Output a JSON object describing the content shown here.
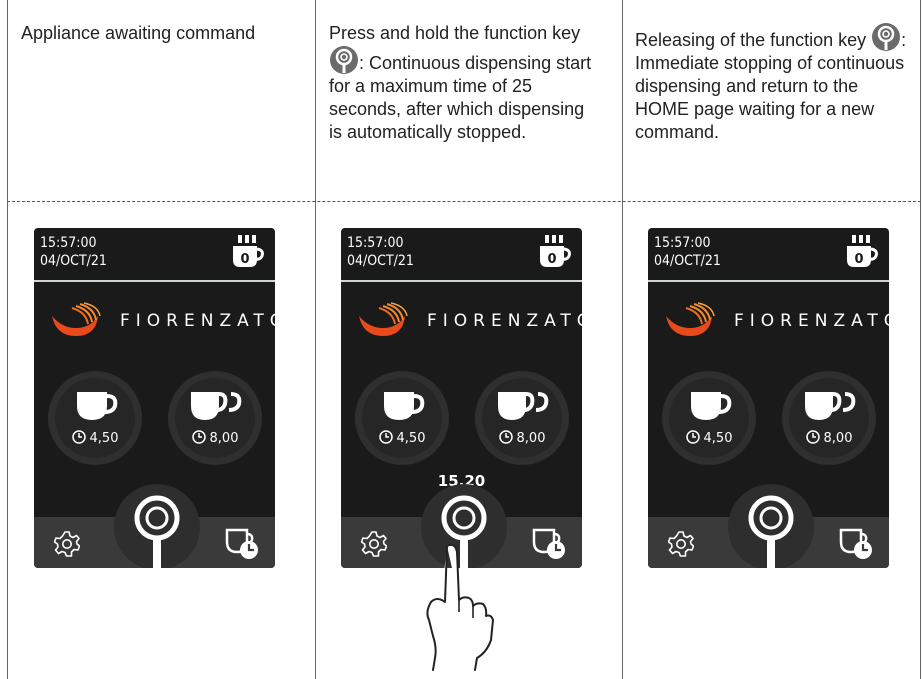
{
  "columns": [
    {
      "text": "Appliance awaiting command"
    },
    {
      "text_before_icon": "Press and hold the function key",
      "text_after_icon": ": Continuous dispensing start for a maximum time of 25 seconds, after which dispensing is automatically stopped."
    },
    {
      "text_before_icon": "Releasing of the function key",
      "text_after_icon": ": Immediate stopping of continuous dispensing and return to the HOME page waiting for a new command."
    }
  ],
  "screen": {
    "time": "15:57:00",
    "date": "04/OCT/21",
    "cup_count": "0",
    "brand": "FIORENZATO",
    "single_dose": "4,50",
    "double_dose": "8,00",
    "dispense_counter": "15,20"
  },
  "colors": {
    "screen_bg": "#1a1a1a",
    "logo_red": "#e84a1c",
    "logo_orange": "#f28a2e"
  }
}
